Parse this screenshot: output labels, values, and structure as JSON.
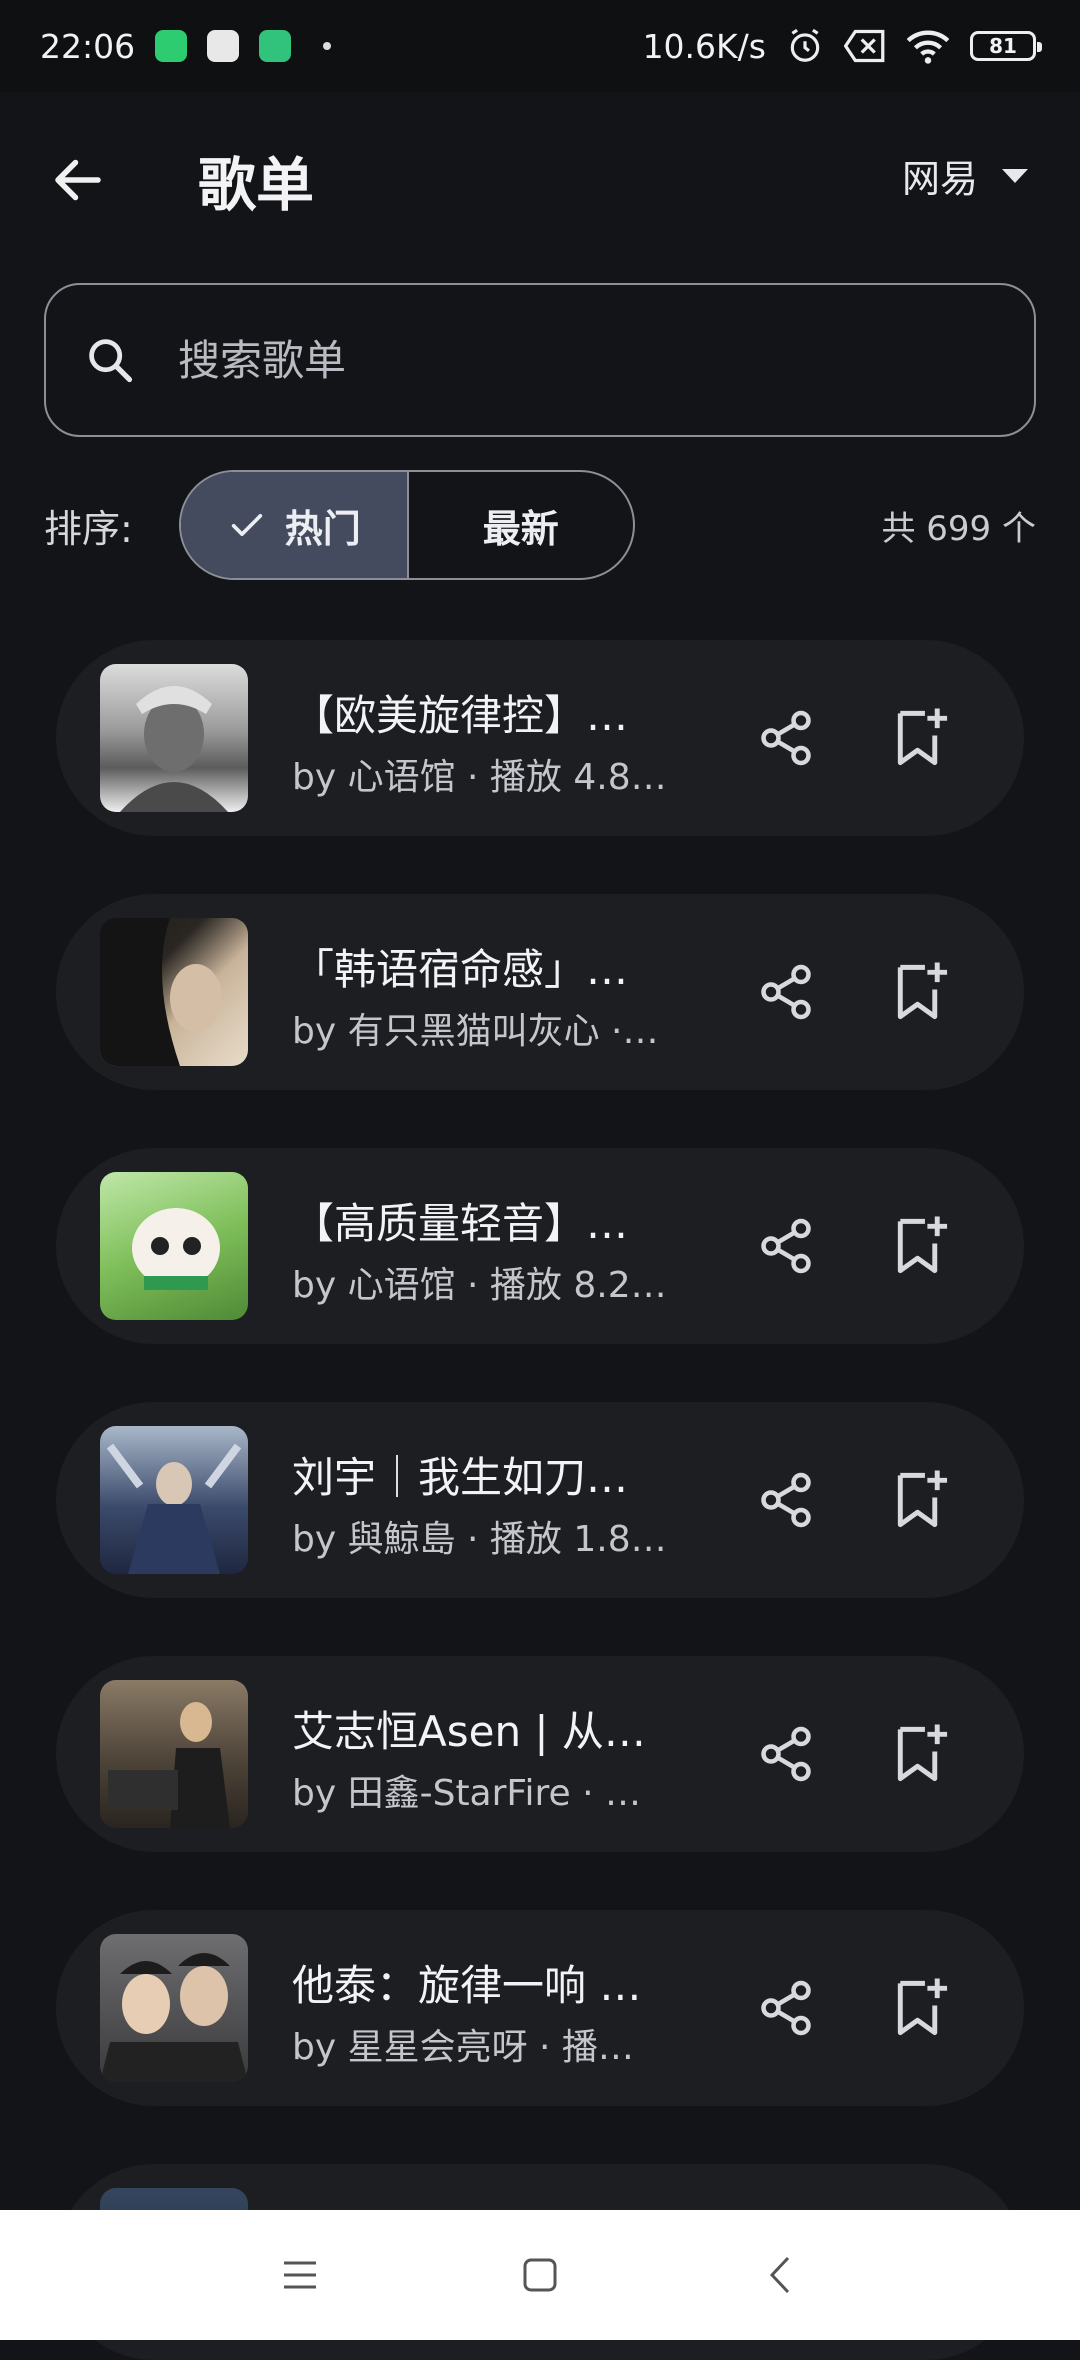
{
  "status_bar": {
    "time": "22:06",
    "net_speed": "10.6K/s",
    "battery": "81"
  },
  "header": {
    "title": "歌单",
    "source": "网易"
  },
  "search": {
    "placeholder": "搜索歌单"
  },
  "sort": {
    "label": "排序:",
    "options": [
      "热门",
      "最新"
    ],
    "selected": "热门",
    "count": "共 699 个"
  },
  "playlists": [
    {
      "title": "【欧美旋律控】…",
      "subtitle": "by 心语馆 · 播放 4.8…"
    },
    {
      "title": "「韩语宿命感」…",
      "subtitle": "by 有只黑猫叫灰心 ·…"
    },
    {
      "title": "【高质量轻音】…",
      "subtitle": "by 心语馆 · 播放 8.2…"
    },
    {
      "title": "刘宇｜我生如刀…",
      "subtitle": "by 與鯨島 · 播放 1.8…"
    },
    {
      "title": "艾志恒Asen | 从…",
      "subtitle": "by 田鑫-StarFire · …"
    },
    {
      "title": "他泰：旋律一响 …",
      "subtitle": "by 星星会亮呀 · 播…"
    }
  ],
  "colors": {
    "background": "#131417",
    "card": "#1d1e22",
    "segment_active": "#454b5e",
    "outline": "#8c8f98"
  }
}
